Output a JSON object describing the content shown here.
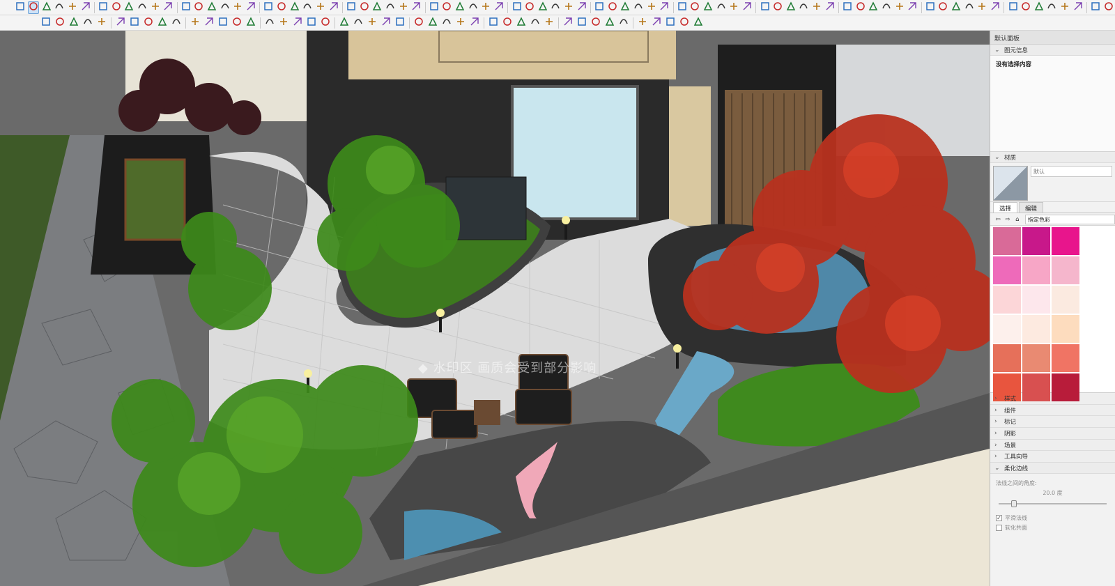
{
  "toolbar_row1": {
    "icons": [
      "zoom-icon",
      "select-icon",
      "eraser-icon",
      "pencil-icon",
      "line-icon",
      "rectangle-icon",
      "push-pull-icon",
      "move-icon",
      "rotate-icon",
      "scale-icon",
      "offset-icon",
      "tape-measure-icon",
      "protractor-icon",
      "follow-me-icon",
      "orbit-icon",
      "pan-icon",
      "zoom-extents-icon",
      "previous-view-icon",
      "section-plane-icon",
      "components-icon",
      "groups-icon",
      "layers-icon",
      "styles-icon",
      "shadows-icon",
      "new-icon",
      "user-icon",
      "open-icon",
      "save-icon",
      "print-icon",
      "import-icon",
      "export-icon",
      "cut-icon",
      "copy-icon",
      "paste-icon",
      "undo-icon",
      "redo-icon",
      "arc-icon",
      "polygon-icon",
      "circle-icon",
      "text-icon",
      "dimension-icon",
      "axes-icon",
      "camera-icon",
      "walk-icon",
      "look-around-icon",
      "position-camera-icon",
      "iso-view-icon",
      "top-view-icon",
      "front-view-icon",
      "right-view-icon",
      "back-view-icon",
      "left-view-icon",
      "xray-icon",
      "wireframe-icon",
      "hidden-line-icon",
      "shaded-icon",
      "textured-icon",
      "monochrome-icon",
      "box-icon",
      "cylinder-icon",
      "sphere-icon",
      "cone-icon",
      "torus-icon",
      "prism-icon",
      "terrain-icon",
      "sandbox-icon",
      "drape-icon",
      "smoove-icon",
      "stamp-icon",
      "flip-edge-icon",
      "add-detail-icon",
      "solid-union-icon",
      "solid-subtract-icon",
      "solid-intersect-icon",
      "outer-shell-icon",
      "trim-icon",
      "split-icon",
      "book-icon",
      "grid-icon",
      "settings-icon"
    ]
  },
  "toolbar_row2": {
    "icons": [
      "curve-icon",
      "curve-edit-icon",
      "spline-icon",
      "weld-icon",
      "gear-icon",
      "pipe-icon",
      "check-icon",
      "chrome-icon",
      "plus-edge-icon",
      "measure-edge-icon",
      "eraser-red-icon",
      "angle-icon",
      "cut-face-icon",
      "trash-icon",
      "bezier-icon",
      "bspline-icon",
      "nurbs-icon",
      "polyline-icon",
      "fillet-icon",
      "bevel-icon",
      "hash-icon",
      "arrow-path-1-icon",
      "arrow-path-2-icon",
      "arrow-path-3-icon",
      "arrow-path-4-icon",
      "arrow-path-5-icon",
      "arrow-path-6-icon",
      "spiral-icon",
      "skin-icon",
      "xyz-icon",
      "bub-icon",
      "flow-icon",
      "soften-icon",
      "texture-icon",
      "checker-icon",
      "material-1-icon",
      "material-2-icon",
      "material-3-icon",
      "material-4-icon",
      "material-5-icon",
      "s-curve-1-icon",
      "s-curve-2-icon",
      "s-curve-3-icon",
      "s-curve-4-icon",
      "car-icon"
    ]
  },
  "viewport": {
    "watermark": "◆  水印区  画质会受到部分影响"
  },
  "tray": {
    "title": "默认面板",
    "entity_info": {
      "header": "图元信息",
      "empty_text": "没有选择内容"
    },
    "materials": {
      "header": "材质",
      "material_name": "默认",
      "tabs": [
        "选择",
        "编辑"
      ],
      "library": "指定色彩",
      "swatches": [
        "#d96a98",
        "#c8188a",
        "#e8158c",
        "#ee6aba",
        "#f7a6c6",
        "#f5b6cc",
        "#fcd6d8",
        "#fde7ec",
        "#fbeae0",
        "#fdf0ec",
        "#fdeae0",
        "#fddcbe",
        "#e6705a",
        "#e98a72",
        "#f07464",
        "#e8553e",
        "#d85050",
        "#b81c3a"
      ]
    },
    "sections": [
      "样式",
      "组件",
      "标记",
      "阴影",
      "场景",
      "工具向导"
    ],
    "soften": {
      "header": "柔化边线",
      "angle_label": "法线之间的角度:",
      "angle_value": "20.0  度",
      "smooth_label": "平滑法线",
      "coplanar_label": "软化共面"
    }
  }
}
